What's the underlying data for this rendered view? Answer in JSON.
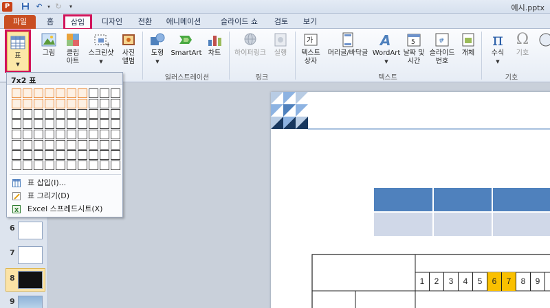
{
  "titlebar": {
    "app_logo": "P",
    "doc_title": "예시.pptx"
  },
  "tabs": [
    "파일",
    "홈",
    "삽입",
    "디자인",
    "전환",
    "애니메이션",
    "슬라이드 쇼",
    "검토",
    "보기"
  ],
  "ribbon": {
    "table_label": "표",
    "image_label": "그림",
    "clipart_label": "클립\n아트",
    "screenshot_label": "스크린샷",
    "photoalbum_label": "사진\n앨범",
    "shapes_label": "도형",
    "smartart_label": "SmartArt",
    "chart_label": "차트",
    "hyperlink_label": "하이퍼링크",
    "action_label": "실행",
    "textbox_label": "텍스트\n상자",
    "headerfooter_label": "머리글/바닥글",
    "wordart_label": "WordArt",
    "datetime_label": "날짜 및\n시간",
    "slidenum_label": "슬라이드\n번호",
    "object_label": "개체",
    "equation_label": "수식",
    "symbol_label": "기호",
    "groups": {
      "illustration": "일러스트레이션",
      "link": "링크",
      "text": "텍스트",
      "symbol": "기호"
    }
  },
  "dropdown": {
    "header": "7x2 표",
    "grid_cols": 10,
    "grid_rows": 8,
    "selected_cols": 7,
    "selected_rows": 2,
    "items": [
      {
        "label": "표 삽입(I)..."
      },
      {
        "label": "표 그리기(D)"
      },
      {
        "label": "Excel 스프레드시트(X)"
      }
    ]
  },
  "slides": [
    {
      "num": "6"
    },
    {
      "num": "7"
    },
    {
      "num": "8"
    },
    {
      "num": "9"
    }
  ],
  "slide_table_numbers": [
    "1",
    "2",
    "3",
    "4",
    "5",
    "6",
    "7",
    "8",
    "9"
  ],
  "colors": {
    "file_tab": "#c94e21",
    "highlight": "#d1145a",
    "table_header": "#4f81bd",
    "table_row": "#d0d8e8",
    "grid_selected": "#e8822a",
    "cell_highlight": "#fac000"
  }
}
